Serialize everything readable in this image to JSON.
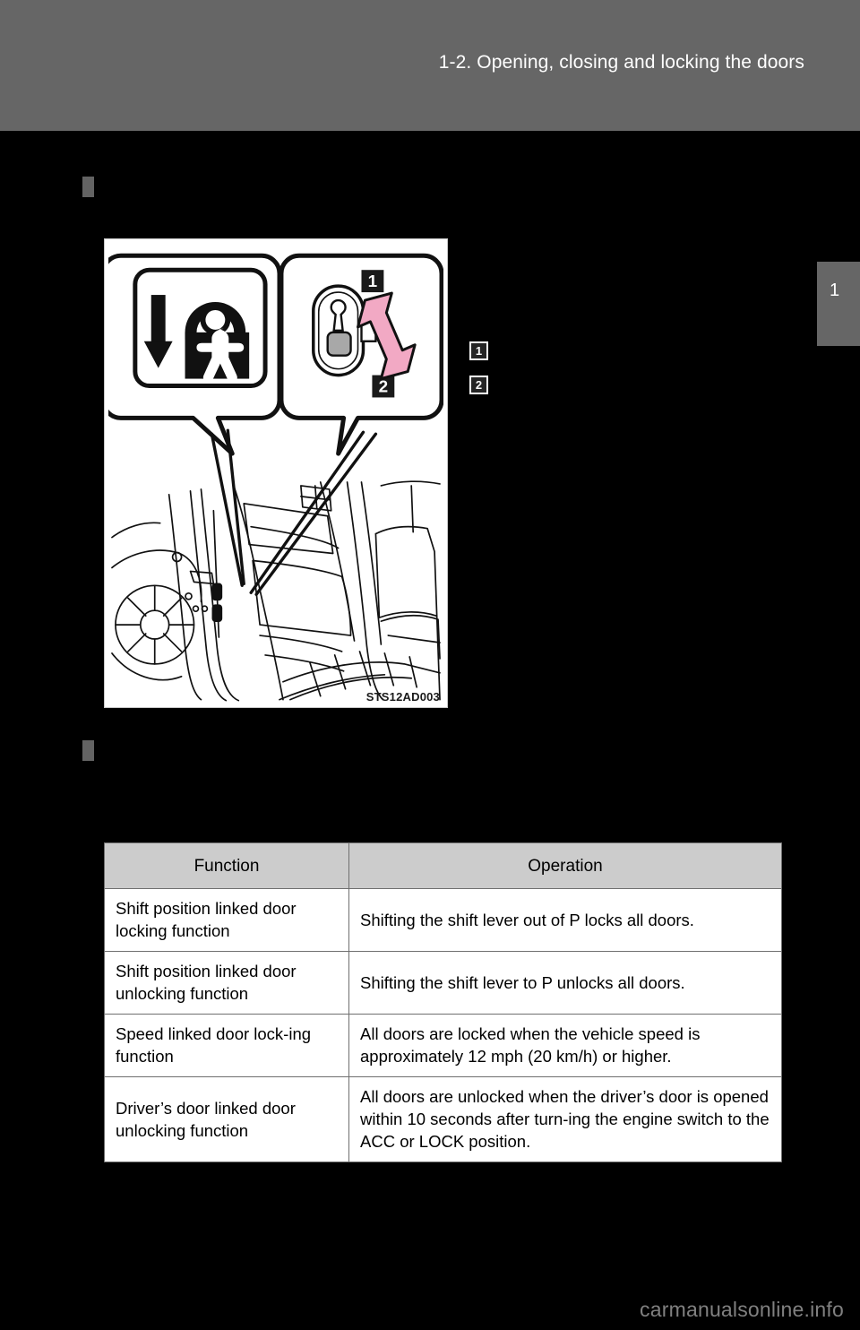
{
  "header": {
    "title": "1-2. Opening, closing and locking the doors",
    "band_color": "#666666",
    "text_color": "#ffffff"
  },
  "chapter_tab": {
    "number": "1",
    "color": "#666666"
  },
  "figure": {
    "caption": "STS12AD003",
    "callouts": [
      {
        "number": "1",
        "meaning": "lock-switch-up-arrow"
      },
      {
        "number": "2",
        "meaning": "lock-switch-down-arrow"
      }
    ],
    "panels": [
      {
        "name": "child-lock-symbol-panel",
        "icon": "child-door-lock-icon"
      },
      {
        "name": "door-lock-switch-panel",
        "icon": "door-lock-switch-icon",
        "arrow_color": "#f0a8c0"
      }
    ],
    "scene": "rear-door-interior-with-door-lock-switch"
  },
  "callout_markers": {
    "one": "1",
    "two": "2"
  },
  "table": {
    "headers": [
      "Function",
      "Operation"
    ],
    "header_bg": "#cccccc",
    "rows": [
      {
        "function": "Shift position linked door locking function",
        "operation": "Shifting the shift lever out of P locks all doors."
      },
      {
        "function": "Shift position linked door unlocking function",
        "operation": "Shifting the shift lever to P unlocks all doors."
      },
      {
        "function": "Speed linked door lock-ing function",
        "operation": "All doors are locked when the vehicle speed is approximately 12 mph (20 km/h) or higher."
      },
      {
        "function": "Driver’s door linked door unlocking function",
        "operation": "All doors are unlocked when the driver’s door is opened within 10 seconds after turn-ing the engine switch to the ACC or LOCK position."
      }
    ]
  },
  "footer": {
    "watermark": "carmanualsonline.info"
  }
}
